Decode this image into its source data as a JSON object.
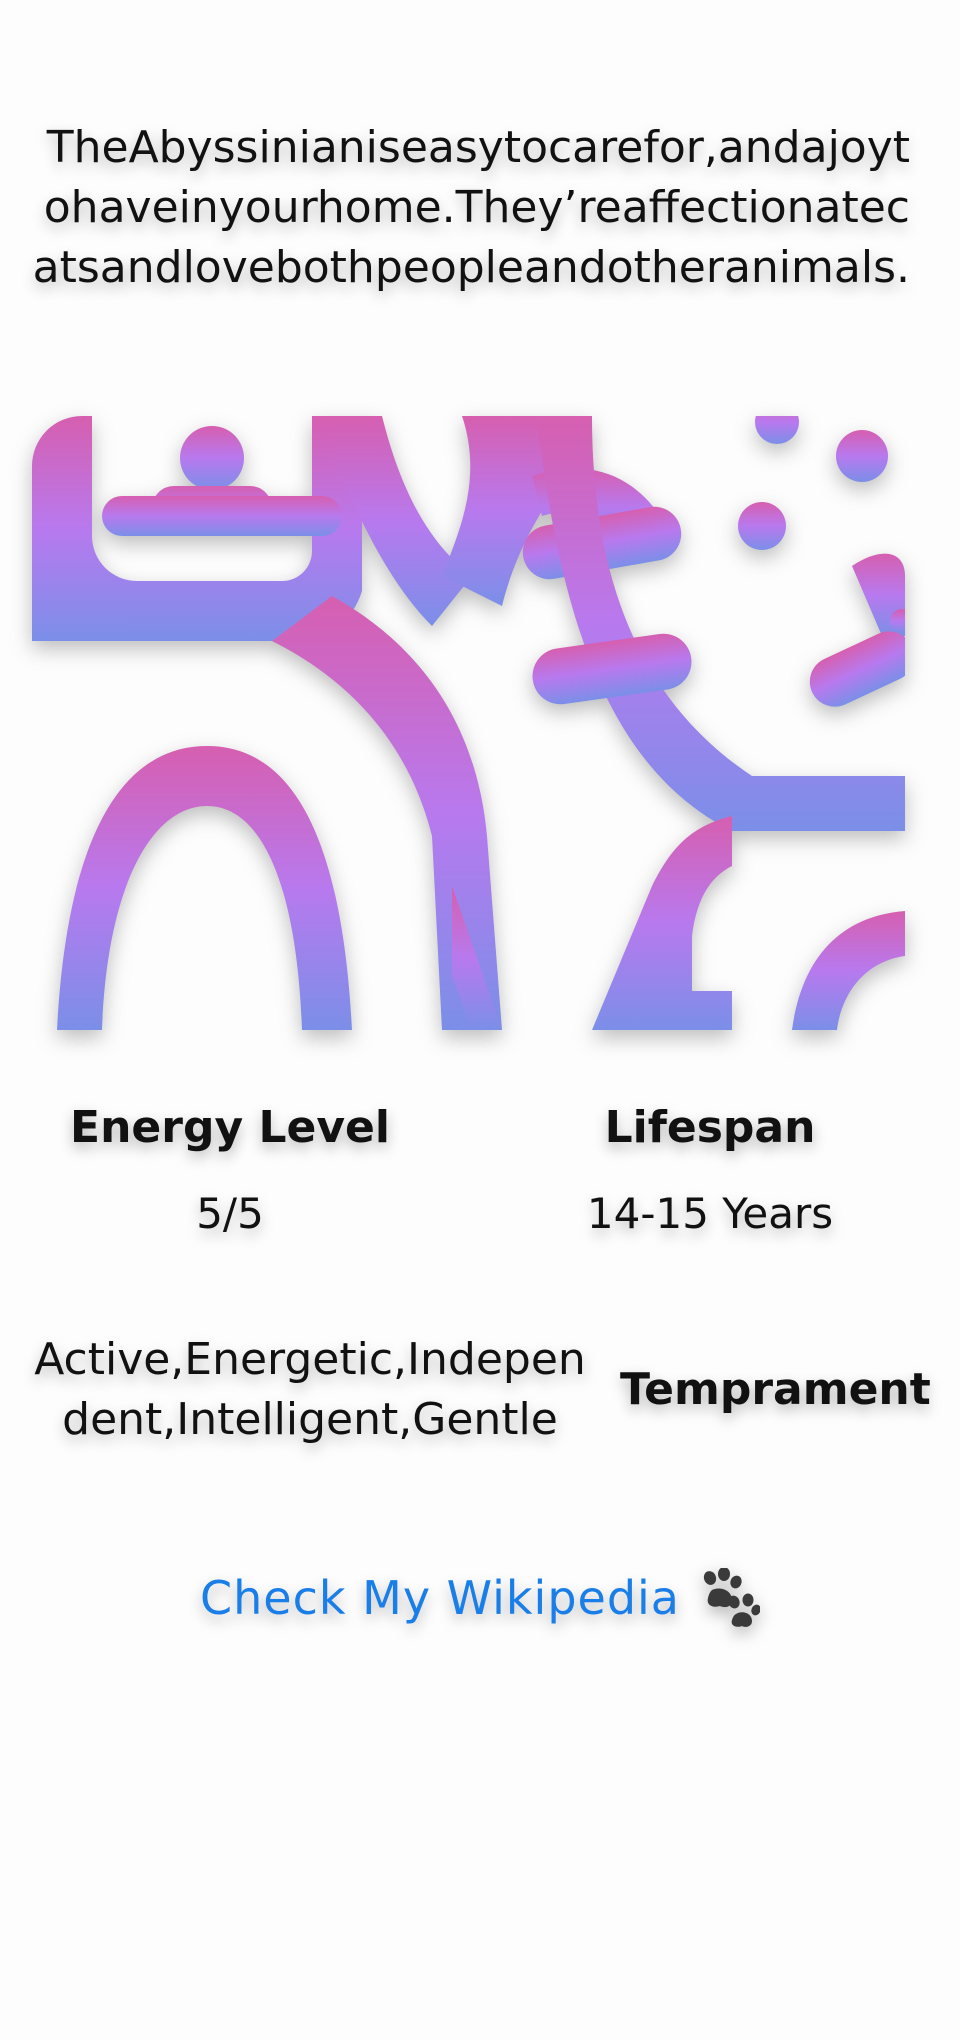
{
  "description": "TheAbyssinianiseasytocarefor,andajoytohaveinyourhome.They’reaffectionatecatsandlovebothpeopleandotheranimals.",
  "image": {
    "icon": "abstract-cat-pattern-image",
    "gradient": {
      "top": "#d65fb0",
      "middle": "#b879ee",
      "bottom": "#7b8fe8"
    }
  },
  "stats": {
    "energy_level": {
      "label": "Energy Level",
      "value": "5/5"
    },
    "lifespan": {
      "label": "Lifespan",
      "value": "14-15 Years"
    },
    "temperament": {
      "label": "Temprament",
      "value": "Active,Energetic,Independent,Intelligent,Gentle"
    }
  },
  "wiki": {
    "link_text": "Check My Wikipedia",
    "icon": "paw-print-icon",
    "link_color": "#1a7ee8"
  }
}
